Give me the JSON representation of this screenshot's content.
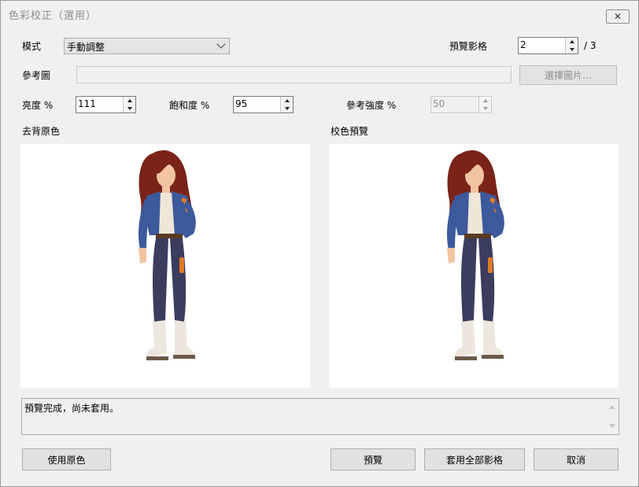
{
  "window": {
    "title": "色彩校正（選用）",
    "close_symbol": "✕"
  },
  "mode": {
    "label": "模式",
    "value": "手動調整"
  },
  "preview_image": {
    "label": "預覽影格",
    "value": "2",
    "total": "/ 3"
  },
  "reference": {
    "label": "參考圖",
    "path_value": "",
    "choose_button": "選擇圖片…"
  },
  "brightness": {
    "label": "亮度 %",
    "value": "111"
  },
  "saturation": {
    "label": "飽和度 %",
    "value": "95"
  },
  "ref_strength": {
    "label": "參考強度 %",
    "value": "50"
  },
  "panels": {
    "left_label": "去背原色",
    "right_label": "校色預覽"
  },
  "status": {
    "text": "預覽完成，尚未套用。"
  },
  "buttons": {
    "use_original": "使用原色",
    "preview": "預覽",
    "apply_all": "套用全部影格",
    "cancel": "取消"
  },
  "colors": {
    "hair": "#7a2318",
    "jacket": "#3c5a9c",
    "jacket_accent": "#e07a28",
    "pants": "#3a3d5e",
    "shirt": "#efe6d8",
    "skin": "#f2c4a2",
    "boots": "#ece6dc"
  }
}
